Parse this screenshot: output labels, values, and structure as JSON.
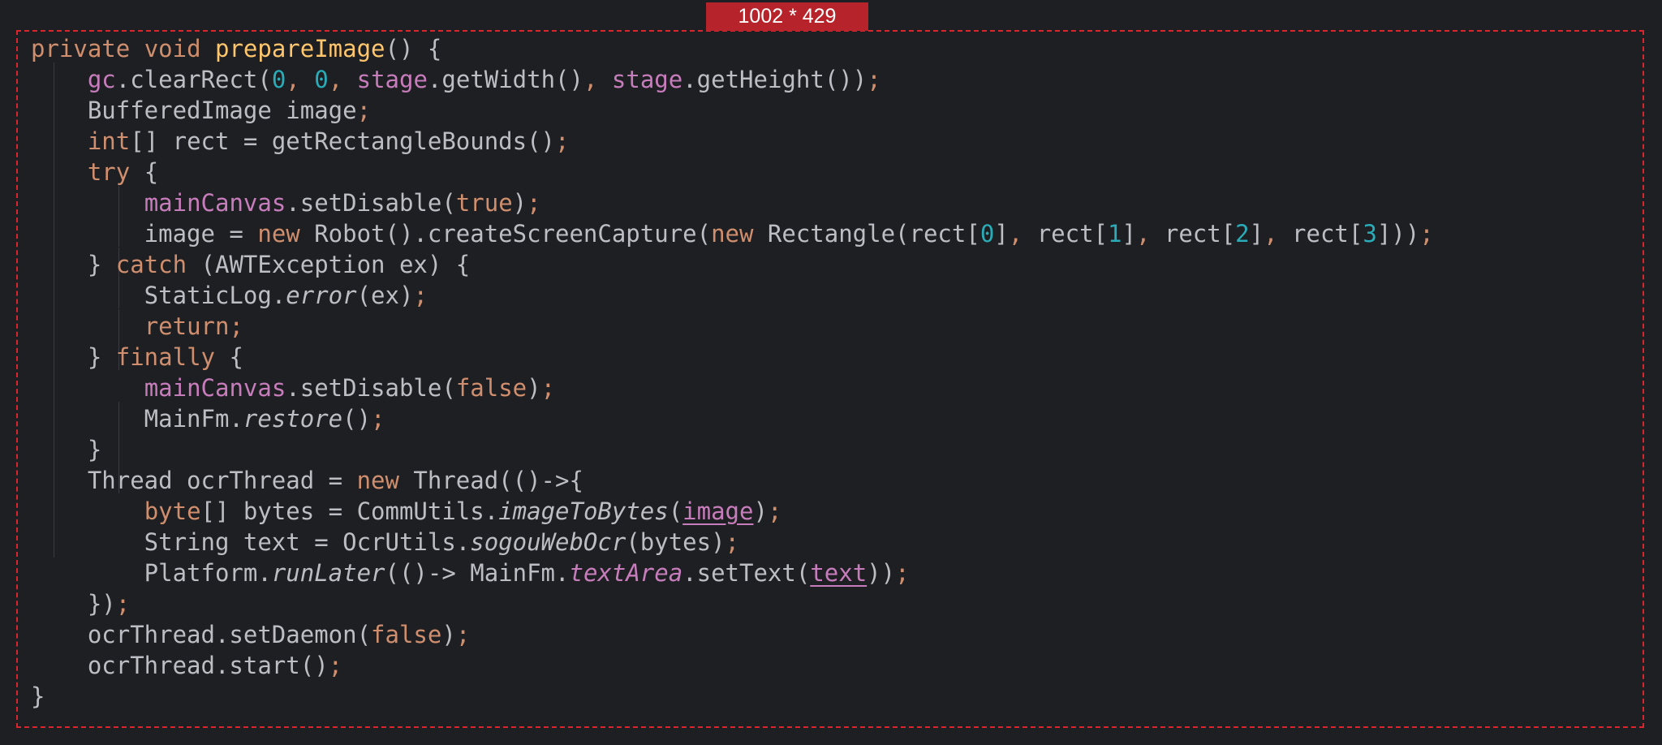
{
  "badge": {
    "size_label": "1002 * 429"
  },
  "colors": {
    "background": "#1e1f22",
    "frame_border": "#d9252d",
    "badge_bg": "#b7232a",
    "keyword": "#cf8e6d",
    "method_decl": "#ffc66d",
    "field": "#c77dbb",
    "number": "#2aacb8",
    "plain": "#bcbec4"
  },
  "code": {
    "lines": [
      [
        {
          "t": "private ",
          "s": "kw"
        },
        {
          "t": "void ",
          "s": "kw"
        },
        {
          "t": "prepareImage",
          "s": "decl"
        },
        {
          "t": "() {",
          "s": "plain"
        }
      ],
      [
        {
          "t": "    ",
          "s": "plain"
        },
        {
          "t": "gc",
          "s": "field"
        },
        {
          "t": ".clearRect(",
          "s": "plain"
        },
        {
          "t": "0",
          "s": "num"
        },
        {
          "t": ", ",
          "s": "punct"
        },
        {
          "t": "0",
          "s": "num"
        },
        {
          "t": ", ",
          "s": "punct"
        },
        {
          "t": "stage",
          "s": "field"
        },
        {
          "t": ".getWidth()",
          "s": "plain"
        },
        {
          "t": ", ",
          "s": "punct"
        },
        {
          "t": "stage",
          "s": "field"
        },
        {
          "t": ".getHeight())",
          "s": "plain"
        },
        {
          "t": ";",
          "s": "punct"
        }
      ],
      [
        {
          "t": "    BufferedImage image",
          "s": "plain"
        },
        {
          "t": ";",
          "s": "punct"
        }
      ],
      [
        {
          "t": "    ",
          "s": "plain"
        },
        {
          "t": "int",
          "s": "kw"
        },
        {
          "t": "[] rect = getRectangleBounds()",
          "s": "plain"
        },
        {
          "t": ";",
          "s": "punct"
        }
      ],
      [
        {
          "t": "    ",
          "s": "plain"
        },
        {
          "t": "try ",
          "s": "kw"
        },
        {
          "t": "{",
          "s": "plain"
        }
      ],
      [
        {
          "t": "        ",
          "s": "plain"
        },
        {
          "t": "mainCanvas",
          "s": "field"
        },
        {
          "t": ".setDisable(",
          "s": "plain"
        },
        {
          "t": "true",
          "s": "kw"
        },
        {
          "t": ")",
          "s": "plain"
        },
        {
          "t": ";",
          "s": "punct"
        }
      ],
      [
        {
          "t": "        image = ",
          "s": "plain"
        },
        {
          "t": "new ",
          "s": "kw"
        },
        {
          "t": "Robot().createScreenCapture(",
          "s": "plain"
        },
        {
          "t": "new ",
          "s": "kw"
        },
        {
          "t": "Rectangle(rect[",
          "s": "plain"
        },
        {
          "t": "0",
          "s": "num"
        },
        {
          "t": "]",
          "s": "plain"
        },
        {
          "t": ", ",
          "s": "punct"
        },
        {
          "t": "rect[",
          "s": "plain"
        },
        {
          "t": "1",
          "s": "num"
        },
        {
          "t": "]",
          "s": "plain"
        },
        {
          "t": ", ",
          "s": "punct"
        },
        {
          "t": "rect[",
          "s": "plain"
        },
        {
          "t": "2",
          "s": "num"
        },
        {
          "t": "]",
          "s": "plain"
        },
        {
          "t": ", ",
          "s": "punct"
        },
        {
          "t": "rect[",
          "s": "plain"
        },
        {
          "t": "3",
          "s": "num"
        },
        {
          "t": "]))",
          "s": "plain"
        },
        {
          "t": ";",
          "s": "punct"
        }
      ],
      [
        {
          "t": "    } ",
          "s": "plain"
        },
        {
          "t": "catch ",
          "s": "kw"
        },
        {
          "t": "(AWTException ex) {",
          "s": "plain"
        }
      ],
      [
        {
          "t": "        StaticLog.",
          "s": "plain"
        },
        {
          "t": "error",
          "s": "italic"
        },
        {
          "t": "(ex)",
          "s": "plain"
        },
        {
          "t": ";",
          "s": "punct"
        }
      ],
      [
        {
          "t": "        ",
          "s": "plain"
        },
        {
          "t": "return;",
          "s": "kw"
        }
      ],
      [
        {
          "t": "    } ",
          "s": "plain"
        },
        {
          "t": "finally ",
          "s": "kw"
        },
        {
          "t": "{",
          "s": "plain"
        }
      ],
      [
        {
          "t": "        ",
          "s": "plain"
        },
        {
          "t": "mainCanvas",
          "s": "field"
        },
        {
          "t": ".setDisable(",
          "s": "plain"
        },
        {
          "t": "false",
          "s": "kw"
        },
        {
          "t": ")",
          "s": "plain"
        },
        {
          "t": ";",
          "s": "punct"
        }
      ],
      [
        {
          "t": "        MainFm.",
          "s": "plain"
        },
        {
          "t": "restore",
          "s": "italic"
        },
        {
          "t": "()",
          "s": "plain"
        },
        {
          "t": ";",
          "s": "punct"
        }
      ],
      [
        {
          "t": "    }",
          "s": "plain"
        }
      ],
      [
        {
          "t": "    Thread ocrThread = ",
          "s": "plain"
        },
        {
          "t": "new ",
          "s": "kw"
        },
        {
          "t": "Thread(()->{",
          "s": "plain"
        }
      ],
      [
        {
          "t": "        ",
          "s": "plain"
        },
        {
          "t": "byte",
          "s": "kw"
        },
        {
          "t": "[] bytes = CommUtils.",
          "s": "plain"
        },
        {
          "t": "imageToBytes",
          "s": "italic"
        },
        {
          "t": "(",
          "s": "plain"
        },
        {
          "t": "image",
          "s": "field-underline"
        },
        {
          "t": ")",
          "s": "plain"
        },
        {
          "t": ";",
          "s": "punct"
        }
      ],
      [
        {
          "t": "        String text = OcrUtils.",
          "s": "plain"
        },
        {
          "t": "sogouWebOcr",
          "s": "italic"
        },
        {
          "t": "(bytes)",
          "s": "plain"
        },
        {
          "t": ";",
          "s": "punct"
        }
      ],
      [
        {
          "t": "        Platform.",
          "s": "plain"
        },
        {
          "t": "runLater",
          "s": "italic"
        },
        {
          "t": "(()-> MainFm.",
          "s": "plain"
        },
        {
          "t": "textArea",
          "s": "field-italic"
        },
        {
          "t": ".setText(",
          "s": "plain"
        },
        {
          "t": "text",
          "s": "field-underline"
        },
        {
          "t": "))",
          "s": "plain"
        },
        {
          "t": ";",
          "s": "punct"
        }
      ],
      [
        {
          "t": "    })",
          "s": "plain"
        },
        {
          "t": ";",
          "s": "punct"
        }
      ],
      [
        {
          "t": "    ocrThread.setDaemon(",
          "s": "plain"
        },
        {
          "t": "false",
          "s": "kw"
        },
        {
          "t": ")",
          "s": "plain"
        },
        {
          "t": ";",
          "s": "punct"
        }
      ],
      [
        {
          "t": "    ocrThread.start()",
          "s": "plain"
        },
        {
          "t": ";",
          "s": "punct"
        }
      ],
      [
        {
          "t": "}",
          "s": "plain"
        }
      ]
    ]
  }
}
